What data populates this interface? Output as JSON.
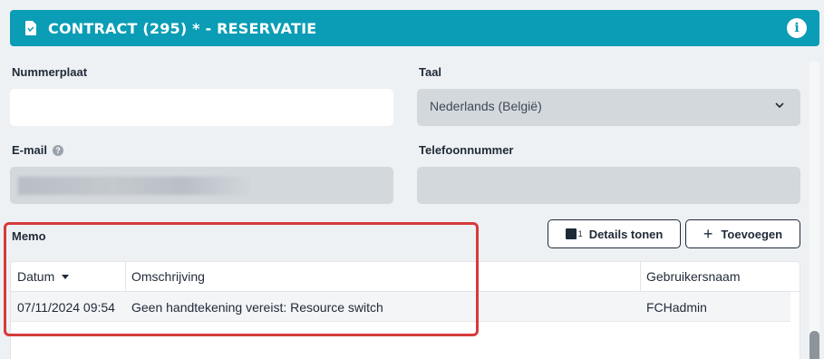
{
  "header": {
    "title": "CONTRACT (295) * - RESERVATIE",
    "doc_icon": "document-icon",
    "info_icon": "info-icon",
    "info_glyph": "i"
  },
  "form": {
    "license_plate": {
      "label": "Nummerplaat",
      "value": ""
    },
    "language": {
      "label": "Taal",
      "value": "Nederlands (België)"
    },
    "email": {
      "label": "E-mail",
      "help_glyph": "?"
    },
    "phone": {
      "label": "Telefoonnummer",
      "value": ""
    }
  },
  "memo": {
    "title": "Memo",
    "details_button": {
      "label": "Details tonen",
      "count": "1"
    },
    "add_button": {
      "label": "Toevoegen",
      "icon": "+"
    },
    "columns": [
      "Datum",
      "Omschrijving",
      "Gebruikersnaam"
    ],
    "rows": [
      {
        "date": "07/11/2024 09:54",
        "description": "Geen handtekening vereist: Resource switch",
        "user": "FCHadmin"
      }
    ]
  },
  "colors": {
    "header_bg": "#0a9db5",
    "highlight": "#d63b3b"
  }
}
